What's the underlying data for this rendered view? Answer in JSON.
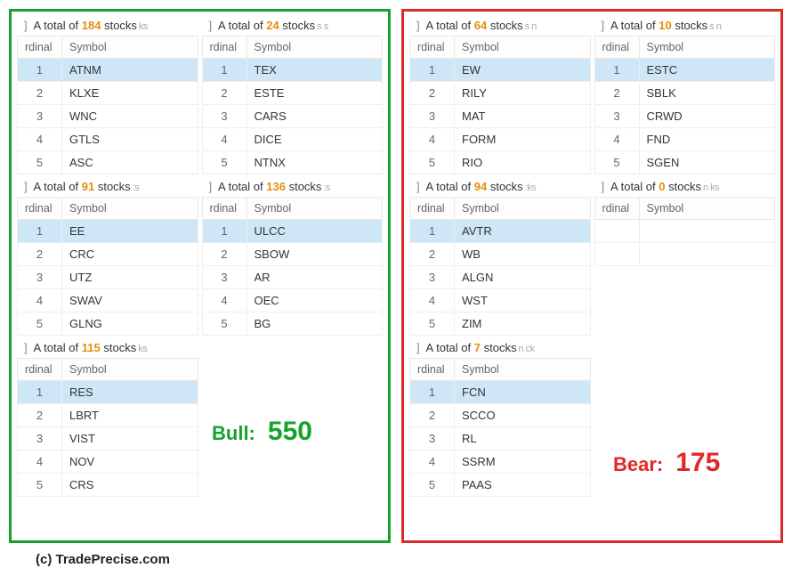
{
  "columns": {
    "ordinal": "rdinal",
    "symbol": "Symbol"
  },
  "total_prefix": "A total of",
  "total_suffix": "stocks",
  "bracket": "]",
  "bull": {
    "label": "Bull:",
    "total": "550",
    "cards": [
      {
        "count": "184",
        "trail": "ks",
        "rows": [
          "ATNM",
          "KLXE",
          "WNC",
          "GTLS",
          "ASC"
        ]
      },
      {
        "count": "91",
        "trail": ":s",
        "rows": [
          "EE",
          "CRC",
          "UTZ",
          "SWAV",
          "GLNG"
        ]
      },
      {
        "count": "115",
        "trail": "ks",
        "rows": [
          "RES",
          "LBRT",
          "VIST",
          "NOV",
          "CRS"
        ]
      },
      {
        "count": "24",
        "trail": "s s",
        "rows": [
          "TEX",
          "ESTE",
          "CARS",
          "DICE",
          "NTNX"
        ]
      },
      {
        "count": "136",
        "trail": ":s",
        "rows": [
          "ULCC",
          "SBOW",
          "AR",
          "OEC",
          "BG"
        ]
      }
    ]
  },
  "bear": {
    "label": "Bear:",
    "total": "175",
    "cards": [
      {
        "count": "64",
        "trail": "s n",
        "rows": [
          "EW",
          "RILY",
          "MAT",
          "FORM",
          "RIO"
        ]
      },
      {
        "count": "94",
        "trail": ":ks",
        "rows": [
          "AVTR",
          "WB",
          "ALGN",
          "WST",
          "ZIM"
        ]
      },
      {
        "count": "7",
        "trail": "n ck",
        "rows": [
          "FCN",
          "SCCO",
          "RL",
          "SSRM",
          "PAAS"
        ]
      },
      {
        "count": "10",
        "trail": "s n",
        "rows": [
          "ESTC",
          "SBLK",
          "CRWD",
          "FND",
          "SGEN"
        ]
      },
      {
        "count": "0",
        "trail": "n ks",
        "rows": []
      }
    ]
  },
  "footer": "(c) TradePrecise.com"
}
